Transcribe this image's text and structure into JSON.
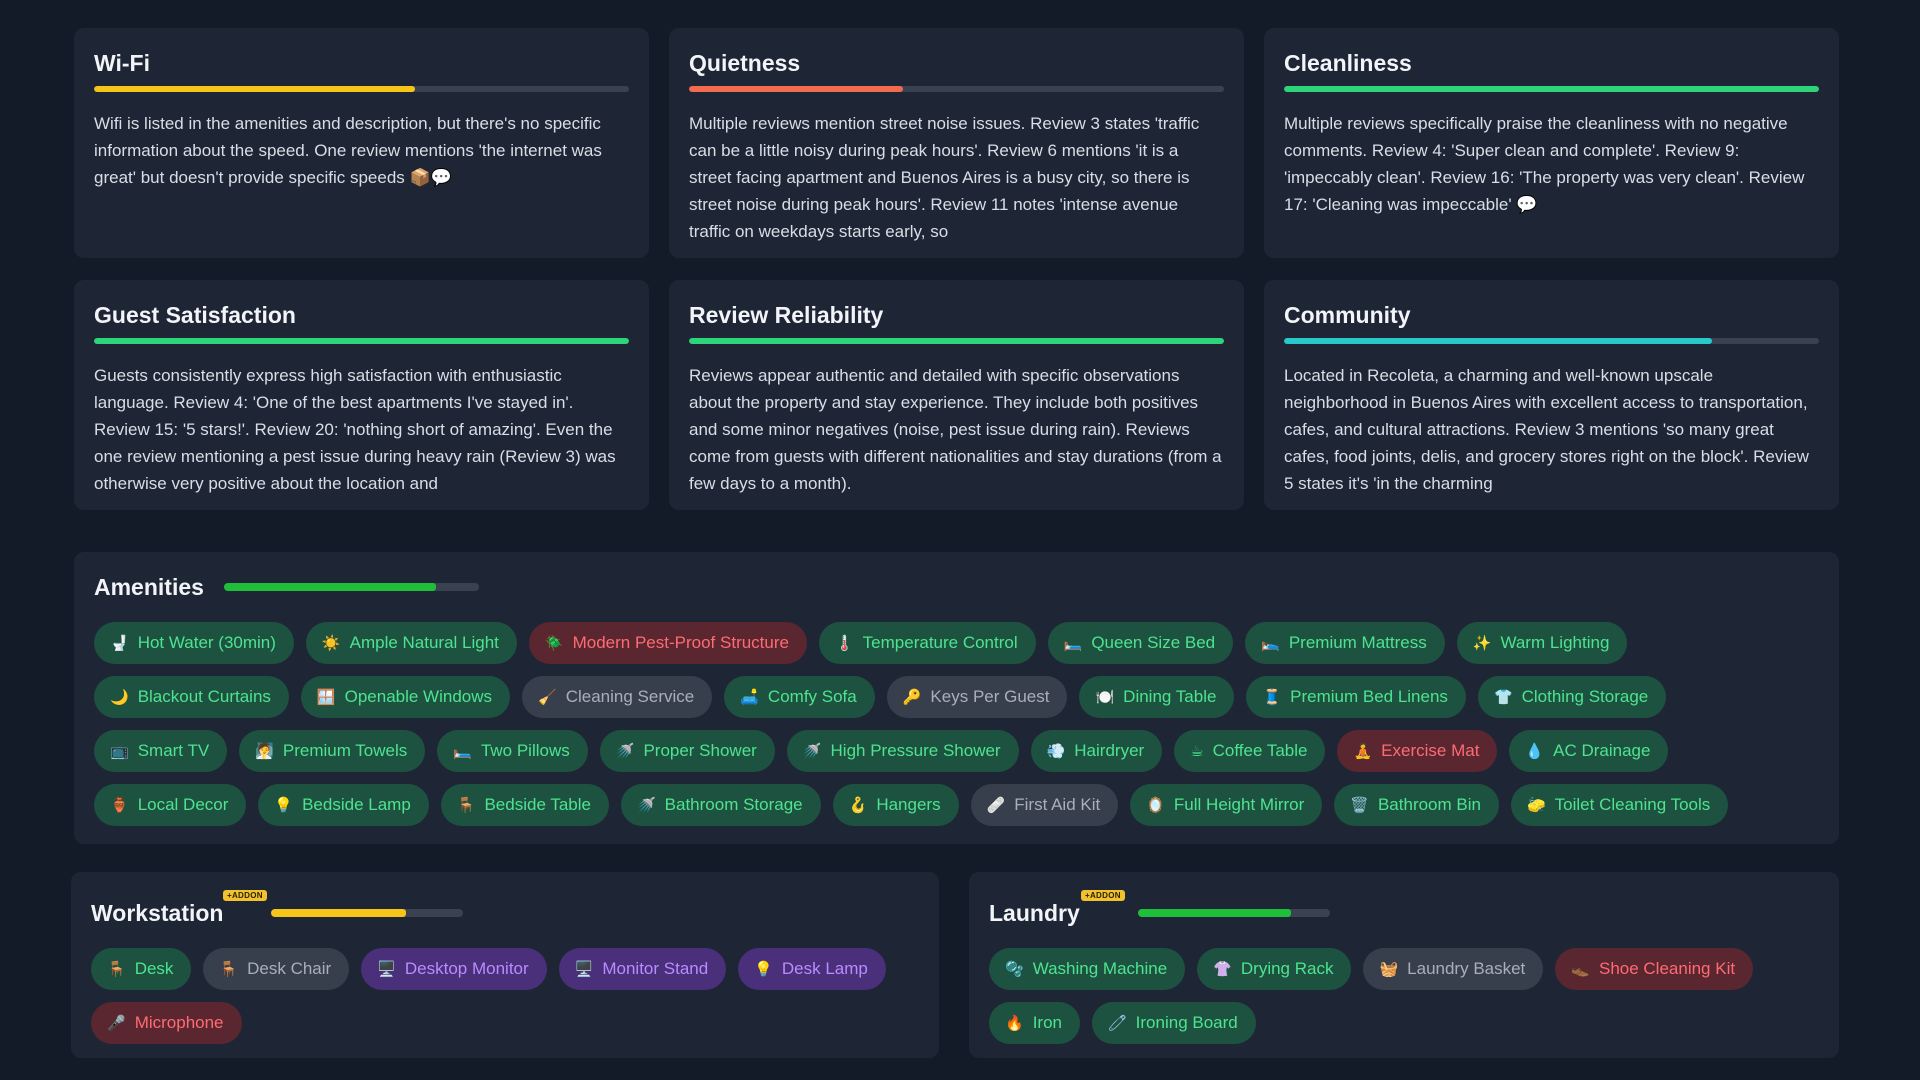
{
  "metrics": [
    {
      "title": "Wi-Fi",
      "fill": 0.6,
      "color": "#f5c518",
      "text": "Wifi is listed in the amenities and description, but there's no specific information about the speed. One review mentions 'the internet was great' but doesn't provide specific speeds 📦💬"
    },
    {
      "title": "Quietness",
      "fill": 0.4,
      "color": "#f26b4f",
      "text": "Multiple reviews mention street noise issues. Review 3 states 'traffic can be a little noisy during peak hours'. Review 6 mentions 'it is a street facing apartment and Buenos Aires is a busy city, so there is street noise during peak hours'. Review 11 notes 'intense avenue traffic on weekdays starts early, so"
    },
    {
      "title": "Cleanliness",
      "fill": 1.0,
      "color": "#2ed47a",
      "text": "Multiple reviews specifically praise the cleanliness with no negative comments. Review 4: 'Super clean and complete'. Review 9: 'impeccably clean'. Review 16: 'The property was very clean'. Review 17: 'Cleaning was impeccable' 💬"
    },
    {
      "title": "Guest Satisfaction",
      "fill": 1.0,
      "color": "#2ed47a",
      "text": "Guests consistently express high satisfaction with enthusiastic language. Review 4: 'One of the best apartments I've stayed in'. Review 15: '5 stars!'. Review 20: 'nothing short of amazing'. Even the one review mentioning a pest issue during heavy rain (Review 3) was otherwise very positive about the location and"
    },
    {
      "title": "Review Reliability",
      "fill": 1.0,
      "color": "#2ed47a",
      "text": "Reviews appear authentic and detailed with specific observations about the property and stay experience. They include both positives and some minor negatives (noise, pest issue during rain). Reviews come from guests with different nationalities and stay durations (from a few days to a month)."
    },
    {
      "title": "Community",
      "fill": 0.8,
      "color": "#27c9c9",
      "text": "Located in Recoleta, a charming and well-known upscale neighborhood in Buenos Aires with excellent access to transportation, cafes, and cultural attractions. Review 3 mentions 'so many great cafes, food joints, delis, and grocery stores right on the block'. Review 5 states it's 'in the charming"
    }
  ],
  "amenities": {
    "title": "Amenities",
    "fill": 0.83,
    "color": "#1fbf3a",
    "items": [
      {
        "icon": "🚽",
        "label": "Hot Water (30min)",
        "s": "g"
      },
      {
        "icon": "☀️",
        "label": "Ample Natural Light",
        "s": "g"
      },
      {
        "icon": "🪲",
        "label": "Modern Pest-Proof Structure",
        "s": "r"
      },
      {
        "icon": "🌡️",
        "label": "Temperature Control",
        "s": "g"
      },
      {
        "icon": "🛏️",
        "label": "Queen Size Bed",
        "s": "g"
      },
      {
        "icon": "🛌",
        "label": "Premium Mattress",
        "s": "g"
      },
      {
        "icon": "✨",
        "label": "Warm Lighting",
        "s": "g"
      },
      {
        "icon": "🌙",
        "label": "Blackout Curtains",
        "s": "g"
      },
      {
        "icon": "🪟",
        "label": "Openable Windows",
        "s": "g"
      },
      {
        "icon": "🧹",
        "label": "Cleaning Service",
        "s": "n"
      },
      {
        "icon": "🛋️",
        "label": "Comfy Sofa",
        "s": "g"
      },
      {
        "icon": "🔑",
        "label": "Keys Per Guest",
        "s": "n"
      },
      {
        "icon": "🍽️",
        "label": "Dining Table",
        "s": "g"
      },
      {
        "icon": "🧵",
        "label": "Premium Bed Linens",
        "s": "g"
      },
      {
        "icon": "👕",
        "label": "Clothing Storage",
        "s": "g"
      },
      {
        "icon": "📺",
        "label": "Smart TV",
        "s": "g"
      },
      {
        "icon": "🧖",
        "label": "Premium Towels",
        "s": "g"
      },
      {
        "icon": "🛏️",
        "label": "Two Pillows",
        "s": "g"
      },
      {
        "icon": "🚿",
        "label": "Proper Shower",
        "s": "g"
      },
      {
        "icon": "🚿",
        "label": "High Pressure Shower",
        "s": "g"
      },
      {
        "icon": "💨",
        "label": "Hairdryer",
        "s": "g"
      },
      {
        "icon": "☕",
        "label": "Coffee Table",
        "s": "g"
      },
      {
        "icon": "🧘",
        "label": "Exercise Mat",
        "s": "r"
      },
      {
        "icon": "💧",
        "label": "AC Drainage",
        "s": "g"
      },
      {
        "icon": "🏺",
        "label": "Local Decor",
        "s": "g"
      },
      {
        "icon": "💡",
        "label": "Bedside Lamp",
        "s": "g"
      },
      {
        "icon": "🪑",
        "label": "Bedside Table",
        "s": "g"
      },
      {
        "icon": "🚿",
        "label": "Bathroom Storage",
        "s": "g"
      },
      {
        "icon": "🪝",
        "label": "Hangers",
        "s": "g"
      },
      {
        "icon": "🩹",
        "label": "First Aid Kit",
        "s": "n"
      },
      {
        "icon": "🪞",
        "label": "Full Height Mirror",
        "s": "g"
      },
      {
        "icon": "🗑️",
        "label": "Bathroom Bin",
        "s": "g"
      },
      {
        "icon": "🧽",
        "label": "Toilet Cleaning Tools",
        "s": "g"
      }
    ]
  },
  "workstation": {
    "title": "Workstation",
    "addon": "+ADDON",
    "fill": 0.7,
    "color": "#f5c518",
    "items": [
      {
        "icon": "🪑",
        "label": "Desk",
        "s": "g"
      },
      {
        "icon": "🪑",
        "label": "Desk Chair",
        "s": "n"
      },
      {
        "icon": "🖥️",
        "label": "Desktop Monitor",
        "s": "p"
      },
      {
        "icon": "🖥️",
        "label": "Monitor Stand",
        "s": "p"
      },
      {
        "icon": "💡",
        "label": "Desk Lamp",
        "s": "p"
      },
      {
        "icon": "🎤",
        "label": "Microphone",
        "s": "r"
      }
    ]
  },
  "laundry": {
    "title": "Laundry",
    "addon": "+ADDON",
    "fill": 0.8,
    "color": "#1fbf3a",
    "items": [
      {
        "icon": "🫧",
        "label": "Washing Machine",
        "s": "g"
      },
      {
        "icon": "👚",
        "label": "Drying Rack",
        "s": "g"
      },
      {
        "icon": "🧺",
        "label": "Laundry Basket",
        "s": "n"
      },
      {
        "icon": "👞",
        "label": "Shoe Cleaning Kit",
        "s": "r"
      },
      {
        "icon": "🔥",
        "label": "Iron",
        "s": "g"
      },
      {
        "icon": "🧷",
        "label": "Ironing Board",
        "s": "g"
      }
    ]
  }
}
